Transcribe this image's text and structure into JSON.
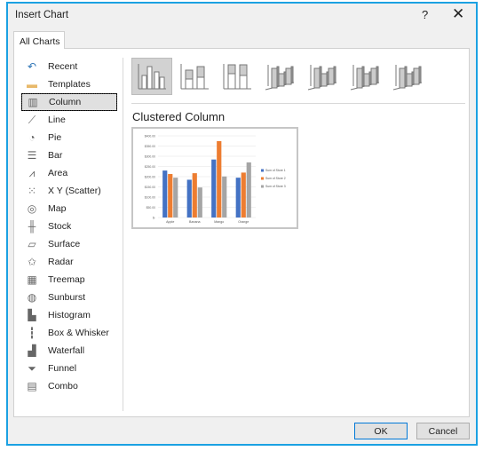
{
  "window": {
    "title": "Insert Chart",
    "help": "?",
    "close": "✕"
  },
  "tabs": [
    {
      "label": "All Charts",
      "active": true
    }
  ],
  "sidebar": {
    "items": [
      {
        "label": "Recent",
        "icon": "recent-icon"
      },
      {
        "label": "Templates",
        "icon": "folder-icon"
      },
      {
        "label": "Column",
        "icon": "column-chart-icon",
        "selected": true
      },
      {
        "label": "Line",
        "icon": "line-chart-icon"
      },
      {
        "label": "Pie",
        "icon": "pie-chart-icon"
      },
      {
        "label": "Bar",
        "icon": "bar-chart-icon"
      },
      {
        "label": "Area",
        "icon": "area-chart-icon"
      },
      {
        "label": "X Y (Scatter)",
        "icon": "scatter-chart-icon"
      },
      {
        "label": "Map",
        "icon": "map-icon"
      },
      {
        "label": "Stock",
        "icon": "stock-chart-icon"
      },
      {
        "label": "Surface",
        "icon": "surface-chart-icon"
      },
      {
        "label": "Radar",
        "icon": "radar-chart-icon"
      },
      {
        "label": "Treemap",
        "icon": "treemap-icon"
      },
      {
        "label": "Sunburst",
        "icon": "sunburst-icon"
      },
      {
        "label": "Histogram",
        "icon": "histogram-icon"
      },
      {
        "label": "Box & Whisker",
        "icon": "box-whisker-icon"
      },
      {
        "label": "Waterfall",
        "icon": "waterfall-icon"
      },
      {
        "label": "Funnel",
        "icon": "funnel-icon"
      },
      {
        "label": "Combo",
        "icon": "combo-chart-icon"
      }
    ]
  },
  "gallery": {
    "selected_index": 0,
    "items": [
      "clustered-column",
      "stacked-column",
      "100-stacked-column",
      "3d-clustered-column",
      "3d-stacked-column",
      "3d-100-stacked-column",
      "3d-column"
    ]
  },
  "main": {
    "chart_type_title": "Clustered Column"
  },
  "preview": {
    "colors": [
      "#4472c4",
      "#ed7d31",
      "#a5a5a5"
    ],
    "y_ticks": [
      "$-",
      "$50.00",
      "$100.00",
      "$150.00",
      "$200.00",
      "$250.00",
      "$300.00",
      "$350.00",
      "$400.00"
    ],
    "ylim": [
      0,
      400
    ],
    "categories": [
      "Apple",
      "Banana",
      "Mango",
      "Orange"
    ],
    "series": [
      {
        "name": "Sum of Store 1",
        "values": [
          230,
          185,
          284,
          195
        ]
      },
      {
        "name": "Sum of Store 2",
        "values": [
          213,
          217,
          374,
          220
        ]
      },
      {
        "name": "Sum of Store 3",
        "values": [
          195,
          147,
          201,
          270
        ]
      }
    ]
  },
  "buttons": {
    "ok": "OK",
    "cancel": "Cancel"
  }
}
